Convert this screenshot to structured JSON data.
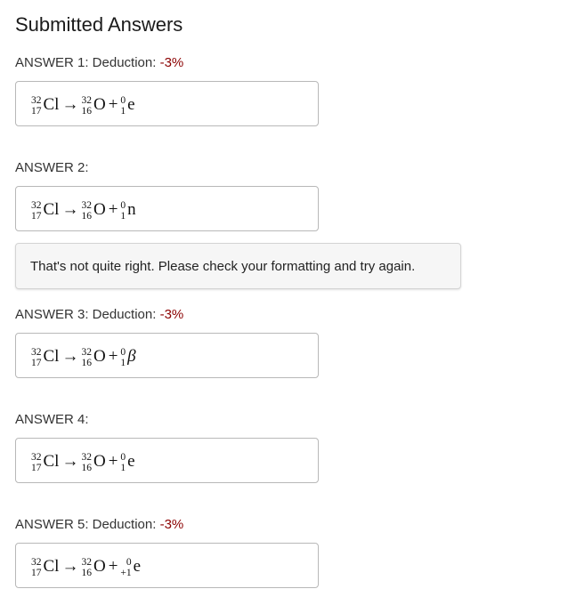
{
  "title": "Submitted Answers",
  "answers": [
    {
      "label": "ANSWER 1:",
      "deduction_label": " Deduction:",
      "deduction_value": "-3%",
      "reactant": {
        "mass": "32",
        "atomic": "17",
        "symbol": "Cl"
      },
      "arrow": "→",
      "product": {
        "mass": "32",
        "atomic": "16",
        "symbol": "O"
      },
      "plus": "+",
      "particle": {
        "mass": "0",
        "atomic": "1",
        "symbol": "e"
      }
    },
    {
      "label": "ANSWER 2:",
      "deduction_label": "",
      "deduction_value": "",
      "reactant": {
        "mass": "32",
        "atomic": "17",
        "symbol": "Cl"
      },
      "arrow": "→",
      "product": {
        "mass": "32",
        "atomic": "16",
        "symbol": "O"
      },
      "plus": "+",
      "particle": {
        "mass": "0",
        "atomic": "1",
        "symbol": "n"
      },
      "feedback": "That's not quite right. Please check your formatting and try again."
    },
    {
      "label": "ANSWER 3:",
      "deduction_label": " Deduction:",
      "deduction_value": "-3%",
      "reactant": {
        "mass": "32",
        "atomic": "17",
        "symbol": "Cl"
      },
      "arrow": "→",
      "product": {
        "mass": "32",
        "atomic": "16",
        "symbol": "O"
      },
      "plus": "+",
      "particle": {
        "mass": "0",
        "atomic": "1",
        "symbol": "β"
      }
    },
    {
      "label": "ANSWER 4:",
      "deduction_label": "",
      "deduction_value": "",
      "reactant": {
        "mass": "32",
        "atomic": "17",
        "symbol": "Cl"
      },
      "arrow": "→",
      "product": {
        "mass": "32",
        "atomic": "16",
        "symbol": "O"
      },
      "plus": "+",
      "particle": {
        "mass": "0",
        "atomic": "1",
        "symbol": "e"
      }
    },
    {
      "label": "ANSWER 5:",
      "deduction_label": " Deduction:",
      "deduction_value": "-3%",
      "reactant": {
        "mass": "32",
        "atomic": "17",
        "symbol": "Cl"
      },
      "arrow": "→",
      "product": {
        "mass": "32",
        "atomic": "16",
        "symbol": "O"
      },
      "plus": "+",
      "particle": {
        "mass": "0",
        "atomic": "+1",
        "symbol": "e"
      }
    }
  ],
  "colors": {
    "deduction": "#8b0000",
    "box_border": "#b8b8b8",
    "feedback_bg": "#f6f6f6"
  }
}
